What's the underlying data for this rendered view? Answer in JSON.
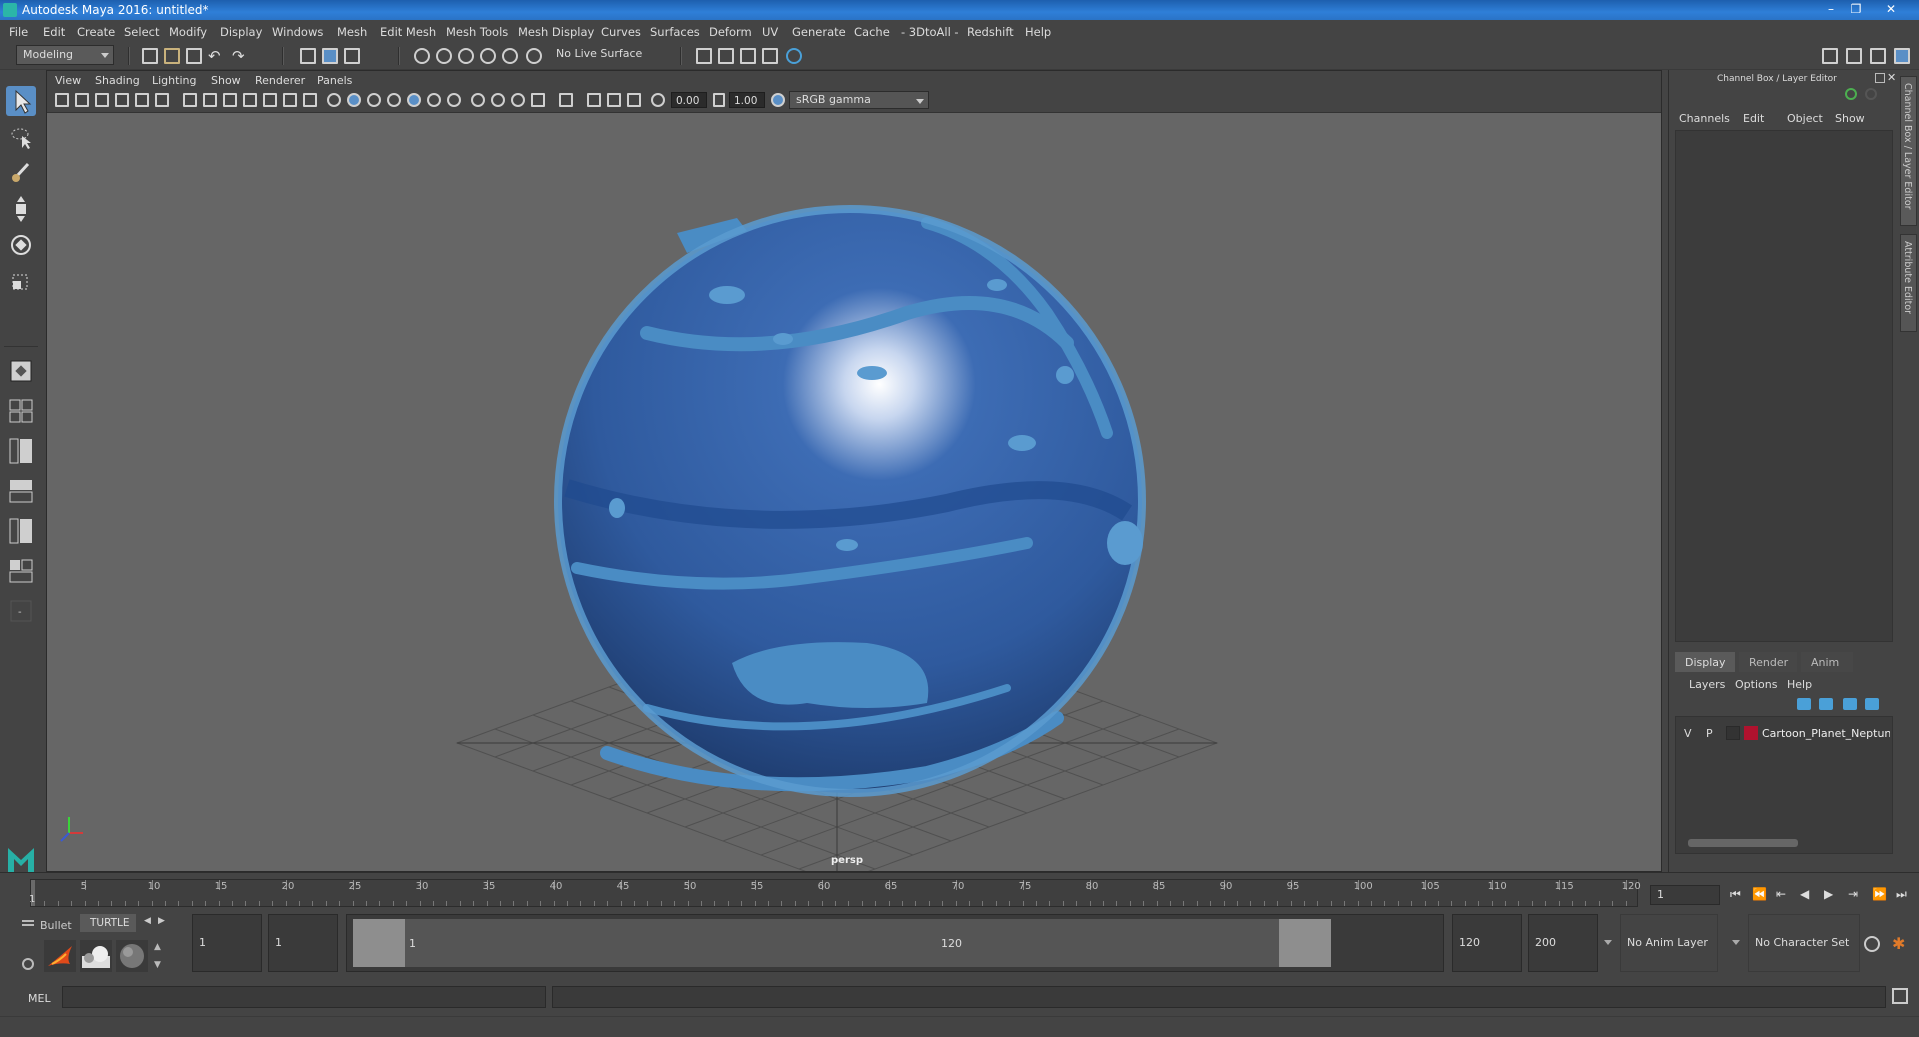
{
  "window": {
    "title": "Autodesk Maya 2016: untitled*",
    "controls": [
      "–",
      "❐",
      "✕"
    ]
  },
  "menubar": [
    "File",
    "Edit",
    "Create",
    "Select",
    "Modify",
    "Display",
    "Windows",
    "Mesh",
    "Edit Mesh",
    "Mesh Tools",
    "Mesh Display",
    "Curves",
    "Surfaces",
    "Deform",
    "UV",
    "Generate",
    "Cache",
    "- 3DtoAll -",
    "Redshift",
    "Help"
  ],
  "statusline": {
    "mode": "Modeling",
    "live_surface": "No Live Surface"
  },
  "viewport": {
    "menus": [
      "View",
      "Shading",
      "Lighting",
      "Show",
      "Renderer",
      "Panels"
    ],
    "exposure": "0.00",
    "gamma": "1.00",
    "color_space": "sRGB gamma",
    "camera_label": "persp"
  },
  "channel_box": {
    "header": "Channel Box / Layer Editor",
    "menus": [
      "Channels",
      "Edit",
      "Object",
      "Show"
    ],
    "tabs": [
      "Display",
      "Render",
      "Anim"
    ],
    "active_tab": "Display",
    "layer_menus": [
      "Layers",
      "Options",
      "Help"
    ],
    "layers": [
      {
        "v": "V",
        "p": "P",
        "name": "Cartoon_Planet_Neptune",
        "color": "#b0122e"
      }
    ]
  },
  "side_tabs": [
    "Channel Box / Layer Editor",
    "Attribute Editor"
  ],
  "timeline": {
    "ticks": [
      "5",
      "10",
      "15",
      "20",
      "25",
      "30",
      "35",
      "40",
      "45",
      "50",
      "55",
      "60",
      "65",
      "70",
      "75",
      "80",
      "85",
      "90",
      "95",
      "100",
      "105",
      "110",
      "115",
      "120"
    ],
    "start_marker": "1",
    "current_frame": "1"
  },
  "shelf": {
    "tabs": [
      "Bullet",
      "TURTLE"
    ]
  },
  "range": {
    "start_time": "1",
    "playback_start": "1",
    "range_start_label": "1",
    "range_end_label": "120",
    "playback_end": "120",
    "end_time": "200",
    "anim_layer": "No Anim Layer",
    "character_set": "No Character Set"
  },
  "command_line": {
    "language": "MEL"
  },
  "colors": {
    "planet_base": "#2f5a9e",
    "planet_band": "#4a8cc4",
    "accent": "#5a8fc6"
  }
}
